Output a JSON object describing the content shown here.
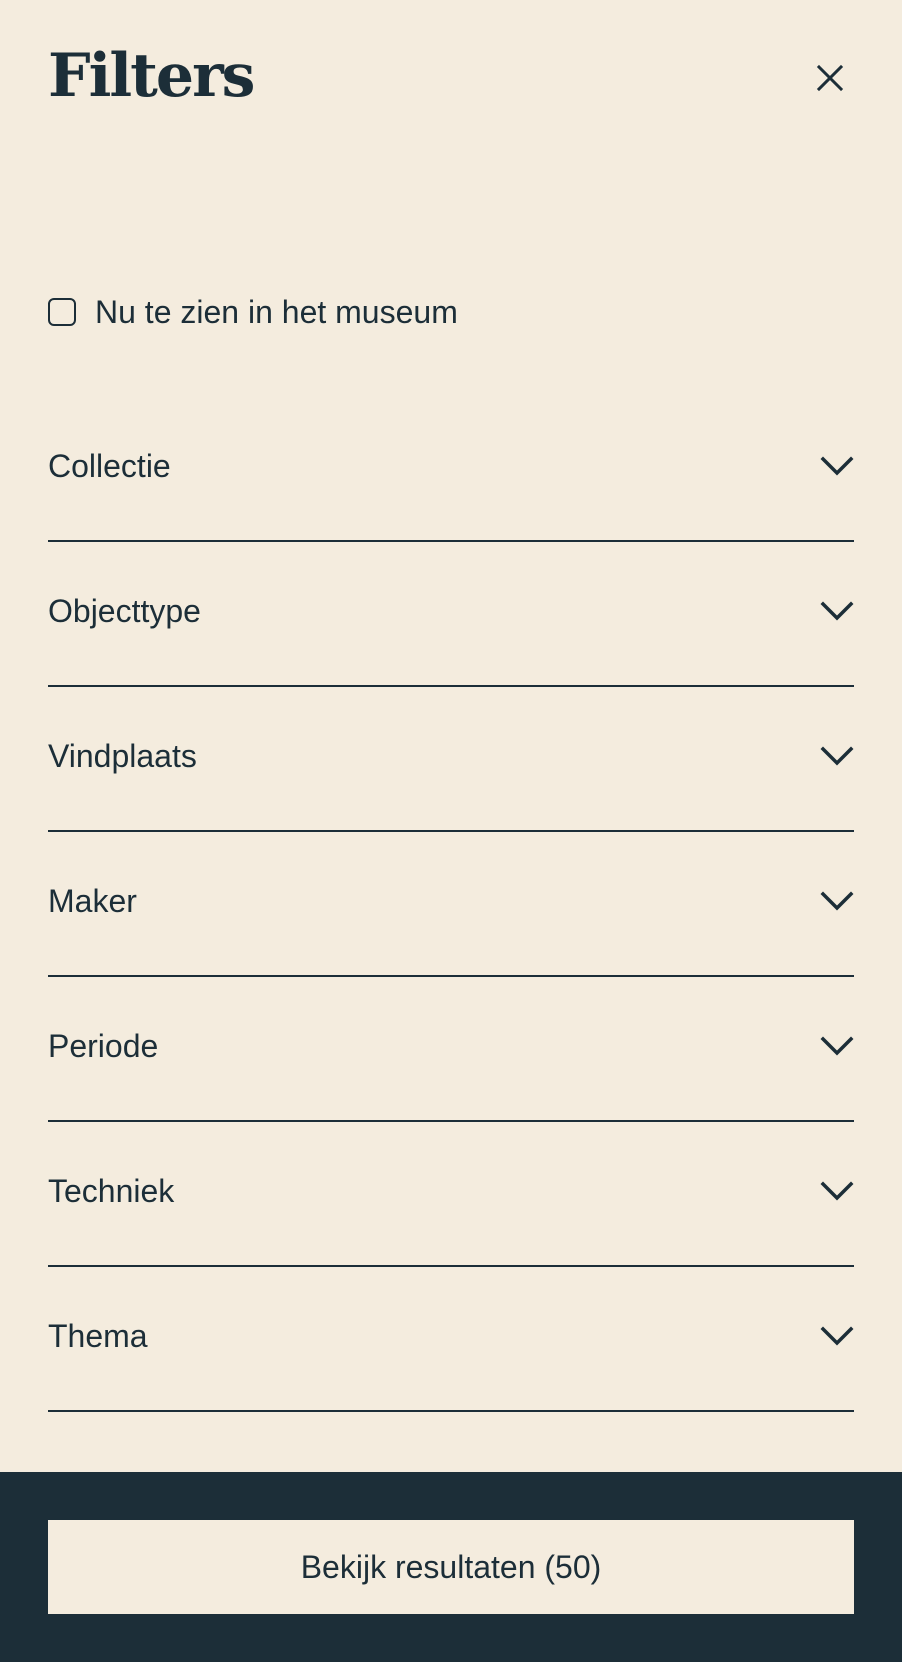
{
  "header": {
    "title": "Filters",
    "close_icon": "close-icon"
  },
  "checkbox": {
    "label": "Nu te zien in het museum",
    "checked": false
  },
  "filters": [
    {
      "label": "Collectie",
      "icon": "chevron-down-icon"
    },
    {
      "label": "Objecttype",
      "icon": "chevron-down-icon"
    },
    {
      "label": "Vindplaats",
      "icon": "chevron-down-icon"
    },
    {
      "label": "Maker",
      "icon": "chevron-down-icon"
    },
    {
      "label": "Periode",
      "icon": "chevron-down-icon"
    },
    {
      "label": "Techniek",
      "icon": "chevron-down-icon"
    },
    {
      "label": "Thema",
      "icon": "chevron-down-icon"
    }
  ],
  "footer": {
    "button_label": "Bekijk resultaten (50)"
  },
  "colors": {
    "background": "#f4ecde",
    "text": "#1c2e38",
    "footer_bg": "#1c2e38"
  }
}
